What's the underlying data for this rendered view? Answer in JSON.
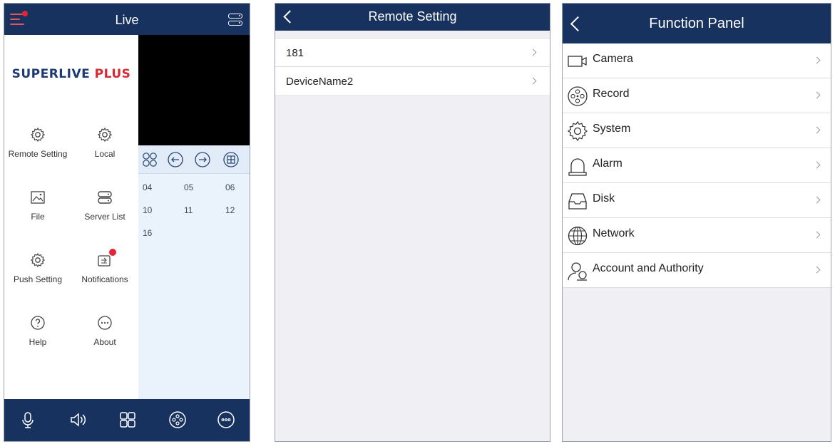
{
  "live": {
    "title": "Live",
    "logo_main": "SUPERLIVE",
    "logo_plus": " PLUS",
    "drawer_items": [
      {
        "label": "Remote Setting",
        "icon": "gear-icon"
      },
      {
        "label": "Local",
        "icon": "gear-icon"
      },
      {
        "label": "File",
        "icon": "image-icon"
      },
      {
        "label": "Server List",
        "icon": "server-list-icon"
      },
      {
        "label": "Push Setting",
        "icon": "gear-icon"
      },
      {
        "label": "Notifications",
        "icon": "notifications-icon"
      },
      {
        "label": "Help",
        "icon": "help-icon"
      },
      {
        "label": "About",
        "icon": "more-icon"
      }
    ],
    "channels": [
      "04",
      "05",
      "06",
      "10",
      "11",
      "12",
      "16"
    ],
    "tabs": [
      "microphone-icon",
      "speaker-icon",
      "layout-grid-icon",
      "record-icon",
      "more-icon"
    ]
  },
  "remote_setting": {
    "title": "Remote Setting",
    "devices": [
      "181",
      "DeviceName2"
    ]
  },
  "function_panel": {
    "title": "Function Panel",
    "items": [
      {
        "label": "Camera",
        "icon": "camera-icon"
      },
      {
        "label": "Record",
        "icon": "record-icon"
      },
      {
        "label": "System",
        "icon": "gear-icon"
      },
      {
        "label": "Alarm",
        "icon": "alarm-bell-icon"
      },
      {
        "label": "Disk",
        "icon": "disk-icon"
      },
      {
        "label": "Network",
        "icon": "network-globe-icon"
      },
      {
        "label": "Account and Authority",
        "icon": "account-icon"
      }
    ]
  },
  "colors": {
    "navbar": "#17325e",
    "accent_red": "#e22638",
    "panel_bg": "#efeff4",
    "grid_bg": "#eaf2fc"
  }
}
